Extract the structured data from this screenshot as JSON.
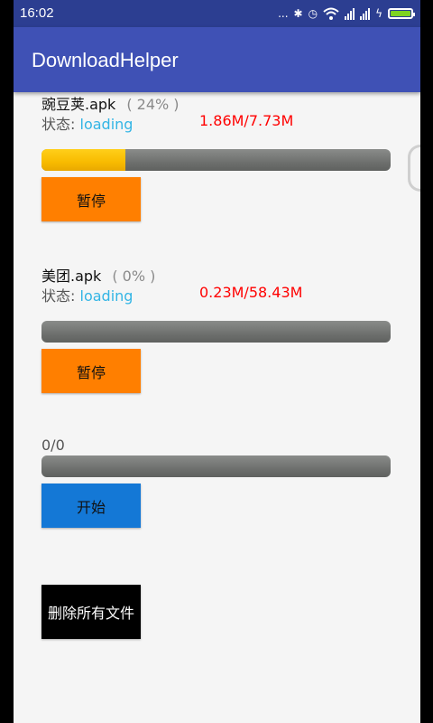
{
  "statusbar": {
    "time": "16:02",
    "more": "...",
    "bluetooth": "✱",
    "alarm": "◷",
    "charge": "ϟ"
  },
  "app": {
    "title": "DownloadHelper"
  },
  "downloads": [
    {
      "name": "豌豆荚.apk",
      "percent": "( 24% )",
      "status_label": "状态:",
      "status_value": "loading",
      "size": "1.86M/7.73M",
      "progress": 0.24,
      "button": "暂停"
    },
    {
      "name": "美团.apk",
      "percent": "( 0% )",
      "status_label": "状态:",
      "status_value": "loading",
      "size": "0.23M/58.43M",
      "progress": 0.0,
      "button": "暂停"
    }
  ],
  "third": {
    "count": "0/0",
    "progress": 0.0,
    "button": "开始"
  },
  "delete_button": "删除所有文件",
  "colors": {
    "accent": "#3f51b5",
    "pause_button": "#ff7f00",
    "start_button": "#1478d6",
    "progress": "#f8bb00",
    "size_text": "#ff0000",
    "status_value": "#33b5e5"
  }
}
